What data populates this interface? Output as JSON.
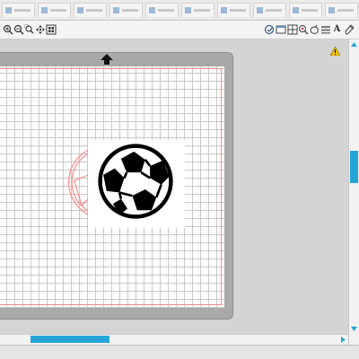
{
  "tabs": [
    {
      "label": ""
    },
    {
      "label": ""
    },
    {
      "label": ""
    },
    {
      "label": ""
    },
    {
      "label": ""
    },
    {
      "label": ""
    },
    {
      "label": ""
    },
    {
      "label": ""
    },
    {
      "label": ""
    },
    {
      "label": ""
    }
  ],
  "toolbar": {
    "left_tools": [
      "zoom-in-icon",
      "zoom-out-icon",
      "zoom-select-icon",
      "pan-icon",
      "fit-to-mat-icon"
    ],
    "right_tools": [
      "send-to-cutter-icon",
      "page-setup-icon",
      "registration-icon",
      "trace-icon",
      "store-icon",
      "library-icon",
      "text-tool-icon",
      "pen-tool-icon"
    ],
    "text_tool_label": "A"
  },
  "canvas": {
    "feed_direction_icon": "up-arrow-icon",
    "warning_icon": "warning-icon",
    "mat_color": "#a9a9a9",
    "cut_line_color": "#ff6b6b"
  },
  "scrollbars": {
    "accent": "#26a6d8",
    "vertical_position": 0.42,
    "horizontal_position": 0.22
  }
}
